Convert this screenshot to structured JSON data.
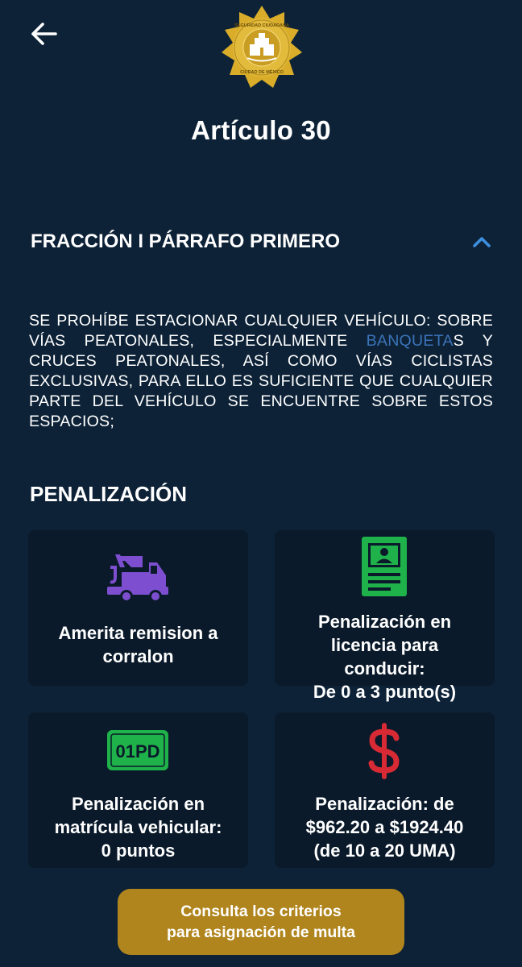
{
  "header": {
    "title": "Artículo 30",
    "logo_text": "SEGURIDAD CIUDADANA · CIUDAD DE MÉXICO"
  },
  "fraction": {
    "title": "FRACCIÓN I PÁRRAFO PRIMERO",
    "expanded": true,
    "text_before": "SE PROHÍBE ESTACIONAR CUALQUIER VEHÍCULO: SOBRE VÍAS PEATONALES, ESPECIALMENTE ",
    "link_text": "BANQUETA",
    "text_after": "S Y CRUCES PEATONALES, ASÍ COMO VÍAS CICLISTAS EXCLUSIVAS, PARA ELLO ES SUFICIENTE QUE CUALQUIER PARTE DEL VEHÍCULO SE ENCUENTRE SOBRE ESTOS ESPACIOS;"
  },
  "penalization": {
    "title": "PENALIZACIÓN",
    "cards": [
      {
        "icon": "tow-truck-icon",
        "text": "Amerita remision a\ncorralon"
      },
      {
        "icon": "license-card-icon",
        "text": "Penalización en\nlicencia para\nconducir:\nDe 0 a 3 punto(s)"
      },
      {
        "icon": "license-plate-icon",
        "plate_text": "01PD",
        "text": "Penalización en\nmatrícula vehicular:\n0 puntos"
      },
      {
        "icon": "dollar-icon",
        "text": "Penalización: de\n$962.20 a $1924.40\n(de 10 a 20 UMA)"
      }
    ]
  },
  "cta": {
    "line1": "Consulta los criterios",
    "line2": "para asignación de multa"
  },
  "colors": {
    "background": "#0d2237",
    "card": "#0a1a2a",
    "accent_gold": "#b0851d",
    "link": "#3a73b8",
    "chevron": "#3d8fe0",
    "tow_purple": "#7d4fd0",
    "license_green": "#1fb24a",
    "dollar_red": "#d82a34"
  }
}
